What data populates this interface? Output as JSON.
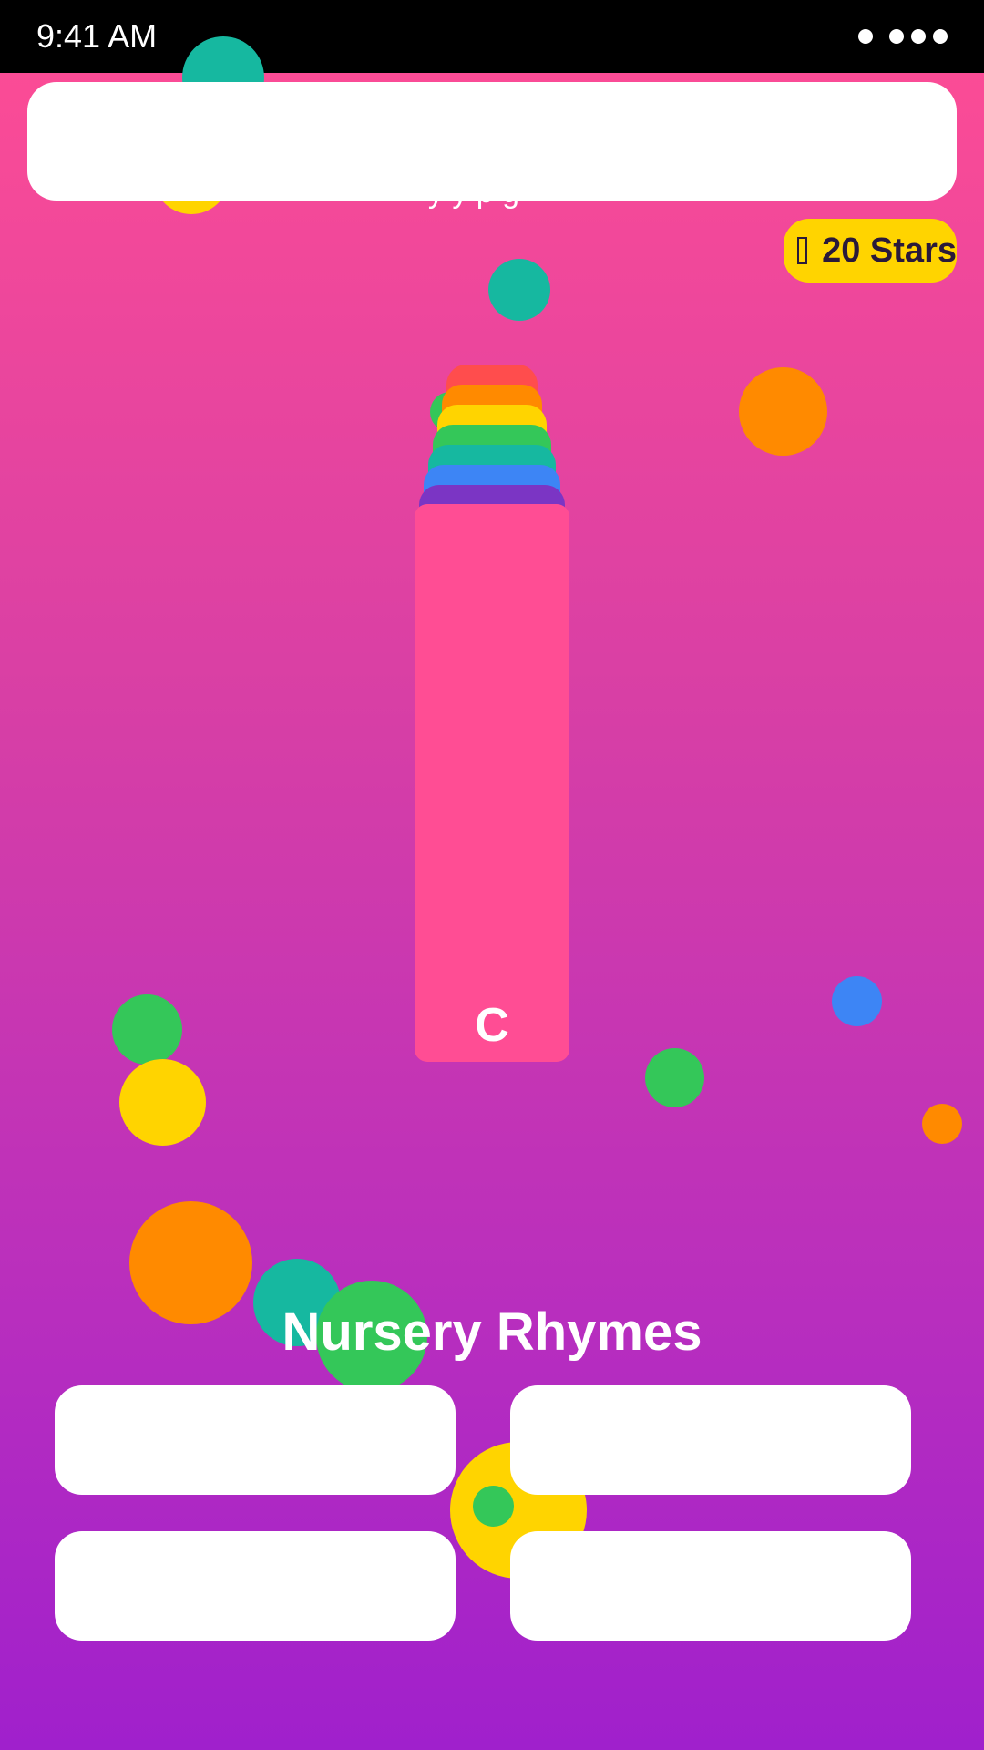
{
  "status": {
    "time": "9:41 AM"
  },
  "header": {
    "subtitle": "y       y       p         g"
  },
  "score": {
    "icon": "star-icon",
    "label": "20 Stars"
  },
  "crayon": {
    "letter": "C",
    "colors": [
      "#ff4d4d",
      "#ff8a00",
      "#ffd400",
      "#34c759",
      "#16b8a0",
      "#3d85f5",
      "#7b35c4",
      "#ff4d94"
    ]
  },
  "section": {
    "title": "Nursery Rhymes"
  },
  "options": [
    {
      "label": ""
    },
    {
      "label": ""
    },
    {
      "label": ""
    },
    {
      "label": ""
    }
  ],
  "colors": {
    "gradient_top": "#ff4d94",
    "gradient_bottom": "#a020cc",
    "accent_yellow": "#ffd400",
    "accent_orange": "#ff8a00",
    "accent_green": "#34c759",
    "accent_teal": "#16b8a0",
    "accent_blue": "#3d85f5"
  }
}
